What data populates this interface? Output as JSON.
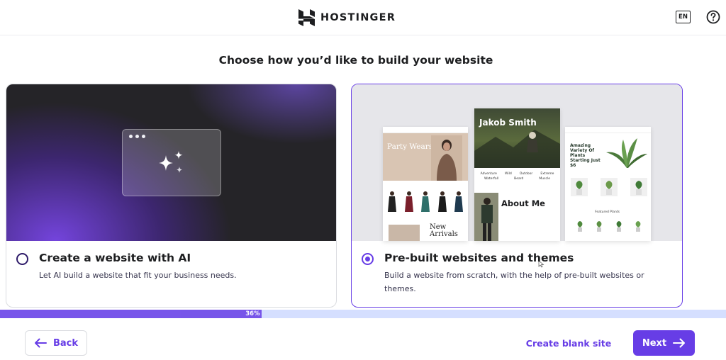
{
  "header": {
    "brand": "HOSTINGER",
    "logo_icon": "hostinger-logo-icon",
    "language": "EN",
    "help_icon": "help-circle-icon"
  },
  "page": {
    "title": "Choose how you’d like to build your website"
  },
  "options": [
    {
      "title": "Create a website with AI",
      "description": "Let AI build a website that fit your business needs.",
      "selected": false,
      "icon": "ai-sparkles-icon"
    },
    {
      "title": "Pre-built websites and themes",
      "description": "Build a website from scratch, with the help of pre-built websites or themes.",
      "selected": true,
      "preview": {
        "left_hero": "Party Wears",
        "left_section": "New Arrivals",
        "center_hero": "Jakob Smith",
        "center_categories": [
          "Adventure",
          "Wild",
          "Outdoor",
          "Extreme",
          "Waterfall",
          "Beard",
          "Muscle"
        ],
        "center_section": "About Me",
        "right_hero": "Amazing Variety Of Plants Starting Just $6",
        "right_section": "Featured Plants"
      }
    }
  ],
  "progress": {
    "label": "36%",
    "value": 0.36
  },
  "footer": {
    "back_label": "Back",
    "blank_label": "Create blank site",
    "next_label": "Next"
  },
  "colors": {
    "accent": "#673de6",
    "progress_track": "#d5dfff",
    "text": "#1d1e20"
  }
}
